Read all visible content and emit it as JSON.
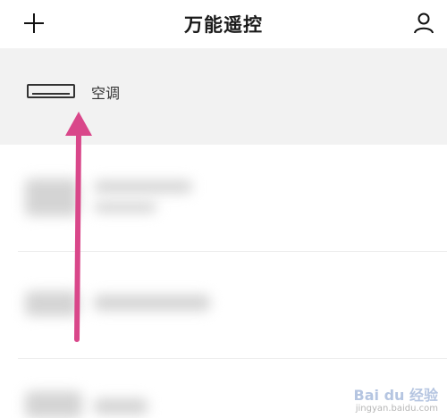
{
  "header": {
    "title": "万能遥控",
    "add_icon": "plus-icon",
    "user_icon": "user-icon"
  },
  "devices": [
    {
      "label": "空调",
      "icon": "air-conditioner-icon"
    }
  ],
  "annotation": {
    "color": "#d9478a"
  },
  "watermark": {
    "brand": "Bai du 经验",
    "url": "jingyan.baidu.com"
  }
}
